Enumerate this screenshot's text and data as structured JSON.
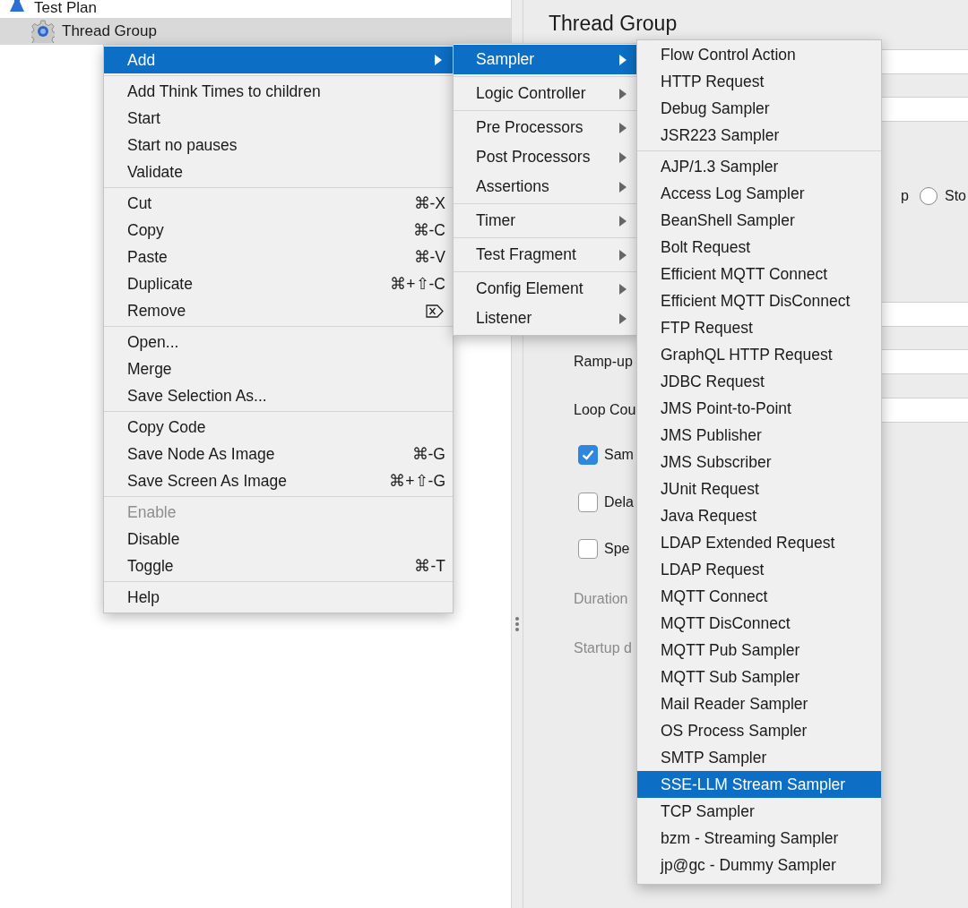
{
  "tree": {
    "items": [
      {
        "label": "Test Plan",
        "kind": "plan",
        "selected": false
      },
      {
        "label": "Thread Group",
        "kind": "thread_group",
        "selected": true
      }
    ]
  },
  "editor": {
    "title": "Thread Group",
    "rows": [
      {
        "kind": "field"
      },
      {
        "kind": "field"
      },
      {
        "kind": "radio",
        "leading_text": "p",
        "label": "Sto",
        "selected": false
      },
      {
        "kind": "field"
      },
      {
        "kind": "labeled_field",
        "label": "Ramp-up",
        "disabled": false
      },
      {
        "kind": "labeled_field",
        "label": "Loop Cou",
        "disabled": false
      },
      {
        "kind": "checkbox",
        "label": "Sam",
        "checked": true
      },
      {
        "kind": "checkbox",
        "label": "Dela",
        "checked": false
      },
      {
        "kind": "checkbox",
        "label": "Spe",
        "checked": false
      },
      {
        "kind": "label",
        "label": "Duration",
        "disabled": true
      },
      {
        "kind": "label",
        "label": "Startup d",
        "disabled": true
      }
    ]
  },
  "context_menu": {
    "groups": [
      [
        {
          "label": "Add",
          "submenu": true,
          "selected": true,
          "disabled": false
        }
      ],
      [
        {
          "label": "Add Think Times to children",
          "submenu": false,
          "selected": false,
          "disabled": false
        },
        {
          "label": "Start",
          "submenu": false,
          "selected": false,
          "disabled": false
        },
        {
          "label": "Start no pauses",
          "submenu": false,
          "selected": false,
          "disabled": false
        },
        {
          "label": "Validate",
          "submenu": false,
          "selected": false,
          "disabled": false
        }
      ],
      [
        {
          "label": "Cut",
          "shortcut": "⌘-X",
          "submenu": false,
          "selected": false,
          "disabled": false
        },
        {
          "label": "Copy",
          "shortcut": "⌘-C",
          "submenu": false,
          "selected": false,
          "disabled": false
        },
        {
          "label": "Paste",
          "shortcut": "⌘-V",
          "submenu": false,
          "selected": false,
          "disabled": false
        },
        {
          "label": "Duplicate",
          "shortcut": "⌘+⇧-C",
          "submenu": false,
          "selected": false,
          "disabled": false
        },
        {
          "label": "Remove",
          "shortcut_icon": true,
          "submenu": false,
          "selected": false,
          "disabled": false
        }
      ],
      [
        {
          "label": "Open...",
          "submenu": false,
          "selected": false,
          "disabled": false
        },
        {
          "label": "Merge",
          "submenu": false,
          "selected": false,
          "disabled": false
        },
        {
          "label": "Save Selection As...",
          "submenu": false,
          "selected": false,
          "disabled": false
        }
      ],
      [
        {
          "label": "Copy Code",
          "submenu": false,
          "selected": false,
          "disabled": false
        },
        {
          "label": "Save Node As Image",
          "shortcut": "⌘-G",
          "submenu": false,
          "selected": false,
          "disabled": false
        },
        {
          "label": "Save Screen As Image",
          "shortcut": "⌘+⇧-G",
          "submenu": false,
          "selected": false,
          "disabled": false
        }
      ],
      [
        {
          "label": "Enable",
          "submenu": false,
          "selected": false,
          "disabled": true
        },
        {
          "label": "Disable",
          "submenu": false,
          "selected": false,
          "disabled": false
        },
        {
          "label": "Toggle",
          "shortcut": "⌘-T",
          "submenu": false,
          "selected": false,
          "disabled": false
        }
      ],
      [
        {
          "label": "Help",
          "submenu": false,
          "selected": false,
          "disabled": false
        }
      ]
    ]
  },
  "add_submenu": {
    "groups": [
      [
        {
          "label": "Sampler",
          "submenu": true,
          "selected": true
        }
      ],
      [
        {
          "label": "Logic Controller",
          "submenu": true,
          "selected": false
        }
      ],
      [
        {
          "label": "Pre Processors",
          "submenu": true,
          "selected": false
        },
        {
          "label": "Post Processors",
          "submenu": true,
          "selected": false
        },
        {
          "label": "Assertions",
          "submenu": true,
          "selected": false
        }
      ],
      [
        {
          "label": "Timer",
          "submenu": true,
          "selected": false
        }
      ],
      [
        {
          "label": "Test Fragment",
          "submenu": true,
          "selected": false
        }
      ],
      [
        {
          "label": "Config Element",
          "submenu": true,
          "selected": false
        },
        {
          "label": "Listener",
          "submenu": true,
          "selected": false
        }
      ]
    ]
  },
  "sampler_submenu": {
    "groups": [
      [
        {
          "label": "Flow Control Action",
          "selected": false
        },
        {
          "label": "HTTP Request",
          "selected": false
        },
        {
          "label": "Debug Sampler",
          "selected": false
        },
        {
          "label": "JSR223 Sampler",
          "selected": false
        }
      ],
      [
        {
          "label": "AJP/1.3 Sampler",
          "selected": false
        },
        {
          "label": "Access Log Sampler",
          "selected": false
        },
        {
          "label": "BeanShell Sampler",
          "selected": false
        },
        {
          "label": "Bolt Request",
          "selected": false
        },
        {
          "label": "Efficient MQTT Connect",
          "selected": false
        },
        {
          "label": "Efficient MQTT DisConnect",
          "selected": false
        },
        {
          "label": "FTP Request",
          "selected": false
        },
        {
          "label": "GraphQL HTTP Request",
          "selected": false
        },
        {
          "label": "JDBC Request",
          "selected": false
        },
        {
          "label": "JMS Point-to-Point",
          "selected": false
        },
        {
          "label": "JMS Publisher",
          "selected": false
        },
        {
          "label": "JMS Subscriber",
          "selected": false
        },
        {
          "label": "JUnit Request",
          "selected": false
        },
        {
          "label": "Java Request",
          "selected": false
        },
        {
          "label": "LDAP Extended Request",
          "selected": false
        },
        {
          "label": "LDAP Request",
          "selected": false
        },
        {
          "label": "MQTT Connect",
          "selected": false
        },
        {
          "label": "MQTT DisConnect",
          "selected": false
        },
        {
          "label": "MQTT Pub Sampler",
          "selected": false
        },
        {
          "label": "MQTT Sub Sampler",
          "selected": false
        },
        {
          "label": "Mail Reader Sampler",
          "selected": false
        },
        {
          "label": "OS Process Sampler",
          "selected": false
        },
        {
          "label": "SMTP Sampler",
          "selected": false
        },
        {
          "label": "SSE-LLM Stream Sampler",
          "selected": true
        },
        {
          "label": "TCP Sampler",
          "selected": false
        },
        {
          "label": "bzm - Streaming Sampler",
          "selected": false
        },
        {
          "label": "jp@gc - Dummy Sampler",
          "selected": false
        }
      ]
    ]
  }
}
